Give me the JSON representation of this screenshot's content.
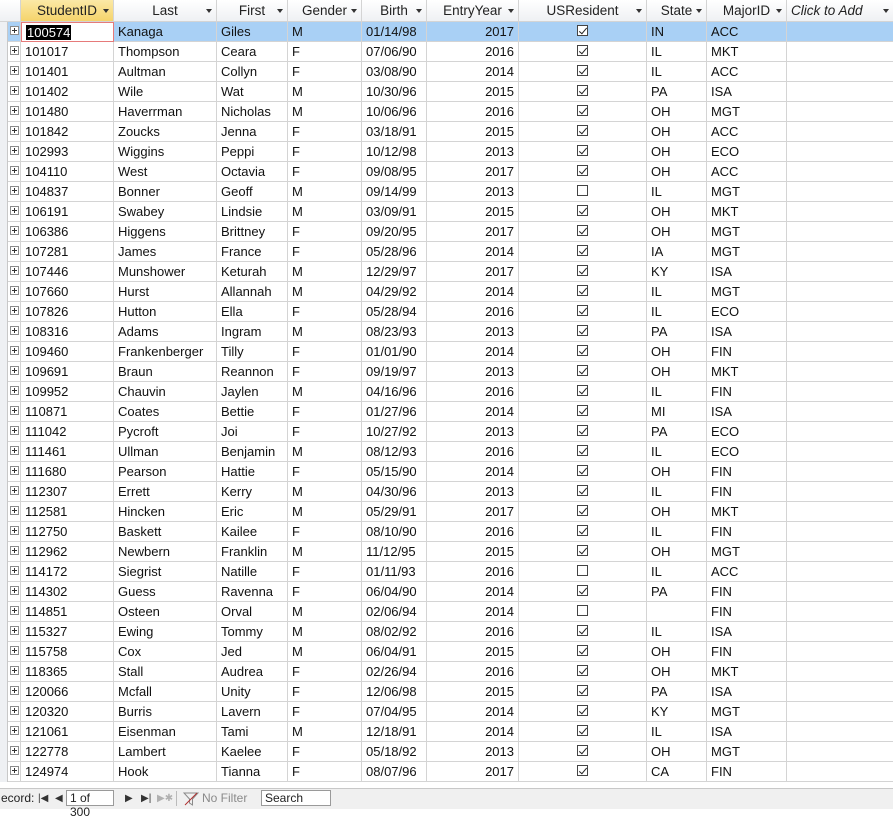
{
  "columns": [
    {
      "key": "StudentID",
      "label": "StudentID"
    },
    {
      "key": "Last",
      "label": "Last"
    },
    {
      "key": "First",
      "label": "First"
    },
    {
      "key": "Gender",
      "label": "Gender"
    },
    {
      "key": "Birth",
      "label": "Birth"
    },
    {
      "key": "EntryYear",
      "label": "EntryYear"
    },
    {
      "key": "USResident",
      "label": "USResident"
    },
    {
      "key": "State",
      "label": "State"
    },
    {
      "key": "MajorID",
      "label": "MajorID"
    }
  ],
  "add_column_label": "Click to Add",
  "rows": [
    {
      "id": "100574",
      "last": "Kanaga",
      "first": "Giles",
      "gender": "M",
      "birth": "01/14/98",
      "year": "2017",
      "us": true,
      "state": "IN",
      "major": "ACC"
    },
    {
      "id": "101017",
      "last": "Thompson",
      "first": "Ceara",
      "gender": "F",
      "birth": "07/06/90",
      "year": "2016",
      "us": true,
      "state": "IL",
      "major": "MKT"
    },
    {
      "id": "101401",
      "last": "Aultman",
      "first": "Collyn",
      "gender": "F",
      "birth": "03/08/90",
      "year": "2014",
      "us": true,
      "state": "IL",
      "major": "ACC"
    },
    {
      "id": "101402",
      "last": "Wile",
      "first": "Wat",
      "gender": "M",
      "birth": "10/30/96",
      "year": "2015",
      "us": true,
      "state": "PA",
      "major": "ISA"
    },
    {
      "id": "101480",
      "last": "Haverrman",
      "first": "Nicholas",
      "gender": "M",
      "birth": "10/06/96",
      "year": "2016",
      "us": true,
      "state": "OH",
      "major": "MGT"
    },
    {
      "id": "101842",
      "last": "Zoucks",
      "first": "Jenna",
      "gender": "F",
      "birth": "03/18/91",
      "year": "2015",
      "us": true,
      "state": "OH",
      "major": "ACC"
    },
    {
      "id": "102993",
      "last": "Wiggins",
      "first": "Peppi",
      "gender": "F",
      "birth": "10/12/98",
      "year": "2013",
      "us": true,
      "state": "OH",
      "major": "ECO"
    },
    {
      "id": "104110",
      "last": "West",
      "first": "Octavia",
      "gender": "F",
      "birth": "09/08/95",
      "year": "2017",
      "us": true,
      "state": "OH",
      "major": "ACC"
    },
    {
      "id": "104837",
      "last": "Bonner",
      "first": "Geoff",
      "gender": "M",
      "birth": "09/14/99",
      "year": "2013",
      "us": false,
      "state": "IL",
      "major": "MGT"
    },
    {
      "id": "106191",
      "last": "Swabey",
      "first": "Lindsie",
      "gender": "M",
      "birth": "03/09/91",
      "year": "2015",
      "us": true,
      "state": "OH",
      "major": "MKT"
    },
    {
      "id": "106386",
      "last": "Higgens",
      "first": "Brittney",
      "gender": "F",
      "birth": "09/20/95",
      "year": "2017",
      "us": true,
      "state": "OH",
      "major": "MGT"
    },
    {
      "id": "107281",
      "last": "James",
      "first": "France",
      "gender": "F",
      "birth": "05/28/96",
      "year": "2014",
      "us": true,
      "state": "IA",
      "major": "MGT"
    },
    {
      "id": "107446",
      "last": "Munshower",
      "first": "Keturah",
      "gender": "M",
      "birth": "12/29/97",
      "year": "2017",
      "us": true,
      "state": "KY",
      "major": "ISA"
    },
    {
      "id": "107660",
      "last": "Hurst",
      "first": "Allannah",
      "gender": "M",
      "birth": "04/29/92",
      "year": "2014",
      "us": true,
      "state": "IL",
      "major": "MGT"
    },
    {
      "id": "107826",
      "last": "Hutton",
      "first": "Ella",
      "gender": "F",
      "birth": "05/28/94",
      "year": "2016",
      "us": true,
      "state": "IL",
      "major": "ECO"
    },
    {
      "id": "108316",
      "last": "Adams",
      "first": "Ingram",
      "gender": "M",
      "birth": "08/23/93",
      "year": "2013",
      "us": true,
      "state": "PA",
      "major": "ISA"
    },
    {
      "id": "109460",
      "last": "Frankenberger",
      "first": "Tilly",
      "gender": "F",
      "birth": "01/01/90",
      "year": "2014",
      "us": true,
      "state": "OH",
      "major": "FIN"
    },
    {
      "id": "109691",
      "last": "Braun",
      "first": "Reannon",
      "gender": "F",
      "birth": "09/19/97",
      "year": "2013",
      "us": true,
      "state": "OH",
      "major": "MKT"
    },
    {
      "id": "109952",
      "last": "Chauvin",
      "first": "Jaylen",
      "gender": "M",
      "birth": "04/16/96",
      "year": "2016",
      "us": true,
      "state": "IL",
      "major": "FIN"
    },
    {
      "id": "110871",
      "last": "Coates",
      "first": "Bettie",
      "gender": "F",
      "birth": "01/27/96",
      "year": "2014",
      "us": true,
      "state": "MI",
      "major": "ISA"
    },
    {
      "id": "111042",
      "last": "Pycroft",
      "first": "Joi",
      "gender": "F",
      "birth": "10/27/92",
      "year": "2013",
      "us": true,
      "state": "PA",
      "major": "ECO"
    },
    {
      "id": "111461",
      "last": "Ullman",
      "first": "Benjamin",
      "gender": "M",
      "birth": "08/12/93",
      "year": "2016",
      "us": true,
      "state": "IL",
      "major": "ECO"
    },
    {
      "id": "111680",
      "last": "Pearson",
      "first": "Hattie",
      "gender": "F",
      "birth": "05/15/90",
      "year": "2014",
      "us": true,
      "state": "OH",
      "major": "FIN"
    },
    {
      "id": "112307",
      "last": "Errett",
      "first": "Kerry",
      "gender": "M",
      "birth": "04/30/96",
      "year": "2013",
      "us": true,
      "state": "IL",
      "major": "FIN"
    },
    {
      "id": "112581",
      "last": "Hincken",
      "first": "Eric",
      "gender": "M",
      "birth": "05/29/91",
      "year": "2017",
      "us": true,
      "state": "OH",
      "major": "MKT"
    },
    {
      "id": "112750",
      "last": "Baskett",
      "first": "Kailee",
      "gender": "F",
      "birth": "08/10/90",
      "year": "2016",
      "us": true,
      "state": "IL",
      "major": "FIN"
    },
    {
      "id": "112962",
      "last": "Newbern",
      "first": "Franklin",
      "gender": "M",
      "birth": "11/12/95",
      "year": "2015",
      "us": true,
      "state": "OH",
      "major": "MGT"
    },
    {
      "id": "114172",
      "last": "Siegrist",
      "first": "Natille",
      "gender": "F",
      "birth": "01/11/93",
      "year": "2016",
      "us": false,
      "state": "IL",
      "major": "ACC"
    },
    {
      "id": "114302",
      "last": "Guess",
      "first": "Ravenna",
      "gender": "F",
      "birth": "06/04/90",
      "year": "2014",
      "us": true,
      "state": "PA",
      "major": "FIN"
    },
    {
      "id": "114851",
      "last": "Osteen",
      "first": "Orval",
      "gender": "M",
      "birth": "02/06/94",
      "year": "2014",
      "us": false,
      "state": "",
      "major": "FIN"
    },
    {
      "id": "115327",
      "last": "Ewing",
      "first": "Tommy",
      "gender": "M",
      "birth": "08/02/92",
      "year": "2016",
      "us": true,
      "state": "IL",
      "major": "ISA"
    },
    {
      "id": "115758",
      "last": "Cox",
      "first": "Jed",
      "gender": "M",
      "birth": "06/04/91",
      "year": "2015",
      "us": true,
      "state": "OH",
      "major": "FIN"
    },
    {
      "id": "118365",
      "last": "Stall",
      "first": "Audrea",
      "gender": "F",
      "birth": "02/26/94",
      "year": "2016",
      "us": true,
      "state": "OH",
      "major": "MKT"
    },
    {
      "id": "120066",
      "last": "Mcfall",
      "first": "Unity",
      "gender": "F",
      "birth": "12/06/98",
      "year": "2015",
      "us": true,
      "state": "PA",
      "major": "ISA"
    },
    {
      "id": "120320",
      "last": "Burris",
      "first": "Lavern",
      "gender": "F",
      "birth": "07/04/95",
      "year": "2014",
      "us": true,
      "state": "KY",
      "major": "MGT"
    },
    {
      "id": "121061",
      "last": "Eisenman",
      "first": "Tami",
      "gender": "M",
      "birth": "12/18/91",
      "year": "2014",
      "us": true,
      "state": "IL",
      "major": "ISA"
    },
    {
      "id": "122778",
      "last": "Lambert",
      "first": "Kaelee",
      "gender": "F",
      "birth": "05/18/92",
      "year": "2013",
      "us": true,
      "state": "OH",
      "major": "MGT"
    },
    {
      "id": "124974",
      "last": "Hook",
      "first": "Tianna",
      "gender": "F",
      "birth": "08/07/96",
      "year": "2017",
      "us": true,
      "state": "CA",
      "major": "FIN"
    }
  ],
  "nav": {
    "record_label": "ecord:",
    "position": "1 of 300",
    "filter_label": "No Filter",
    "search_label": "Search",
    "first_icon": "first-record-icon",
    "prev_icon": "prev-record-icon",
    "next_icon": "next-record-icon",
    "last_icon": "last-record-icon",
    "new_icon": "new-record-icon",
    "filter_icon": "funnel-icon"
  }
}
